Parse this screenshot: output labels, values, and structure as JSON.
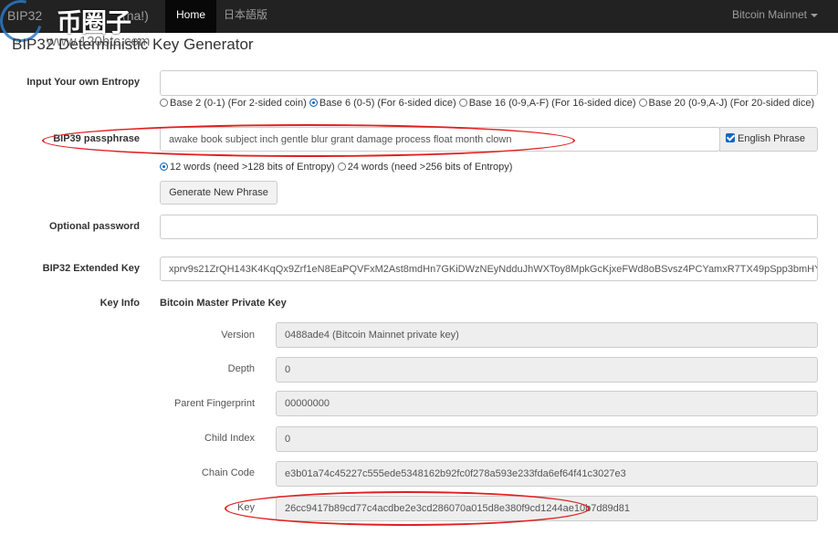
{
  "navbar": {
    "brand": "BIP32",
    "brand_suffix": "(na!)",
    "watermark": "币圈子",
    "tabs": [
      {
        "label": "Home",
        "active": true
      },
      {
        "label": "日本語版",
        "active": false
      }
    ],
    "network": "Bitcoin Mainnet"
  },
  "page": {
    "title": "BIP32 Deterministic Key Generator",
    "title_overlay": "www.120btc.com"
  },
  "entropy": {
    "label": "Input Your own Entropy",
    "value": "",
    "bases": [
      {
        "label": "Base 2 (0-1) (For 2-sided coin)",
        "selected": false
      },
      {
        "label": "Base 6 (0-5) (For 6-sided dice)",
        "selected": true
      },
      {
        "label": "Base 16 (0-9,A-F) (For 16-sided dice)",
        "selected": false
      },
      {
        "label": "Base 20 (0-9,A-J) (For 20-sided dice)",
        "selected": false
      }
    ]
  },
  "passphrase": {
    "label": "BIP39 passphrase",
    "value": "awake book subject inch gentle blur grant damage process float month clown",
    "english_phrase_label": "English Phrase",
    "english_phrase_checked": true,
    "word_options": [
      {
        "label": "12 words (need >128 bits of Entropy)",
        "selected": true
      },
      {
        "label": "24 words (need >256 bits of Entropy)",
        "selected": false
      }
    ],
    "generate_label": "Generate New Phrase"
  },
  "optional_password": {
    "label": "Optional password",
    "value": ""
  },
  "extended_key": {
    "label": "BIP32 Extended Key",
    "value": "xprv9s21ZrQH143K4KqQx9Zrf1eN8EaPQVFxM2Ast8mdHn7GKiDWzNEyNdduJhWXToy8MpkGcKjxeFWd8oBSvsz4PCYamxR7TX49pSpp3bmHY"
  },
  "key_info": {
    "label": "Key Info",
    "heading": "Bitcoin Master Private Key",
    "fields": [
      {
        "label": "Version",
        "value": "0488ade4 (Bitcoin Mainnet private key)"
      },
      {
        "label": "Depth",
        "value": "0"
      },
      {
        "label": "Parent Fingerprint",
        "value": "00000000"
      },
      {
        "label": "Child Index",
        "value": "0"
      },
      {
        "label": "Chain Code",
        "value": "e3b01a74c45227c555ede5348162b92fc0f278a593e233fda6ef64f41c3027e3"
      },
      {
        "label": "Key",
        "value": "26cc9417b89cd77c4acdbe2e3cd286070a015d8e380f9cd1244ae10b7d89d81"
      }
    ]
  },
  "colors": {
    "navbar_bg": "#222222",
    "accent": "#1565c0",
    "annotation": "#e02020"
  }
}
